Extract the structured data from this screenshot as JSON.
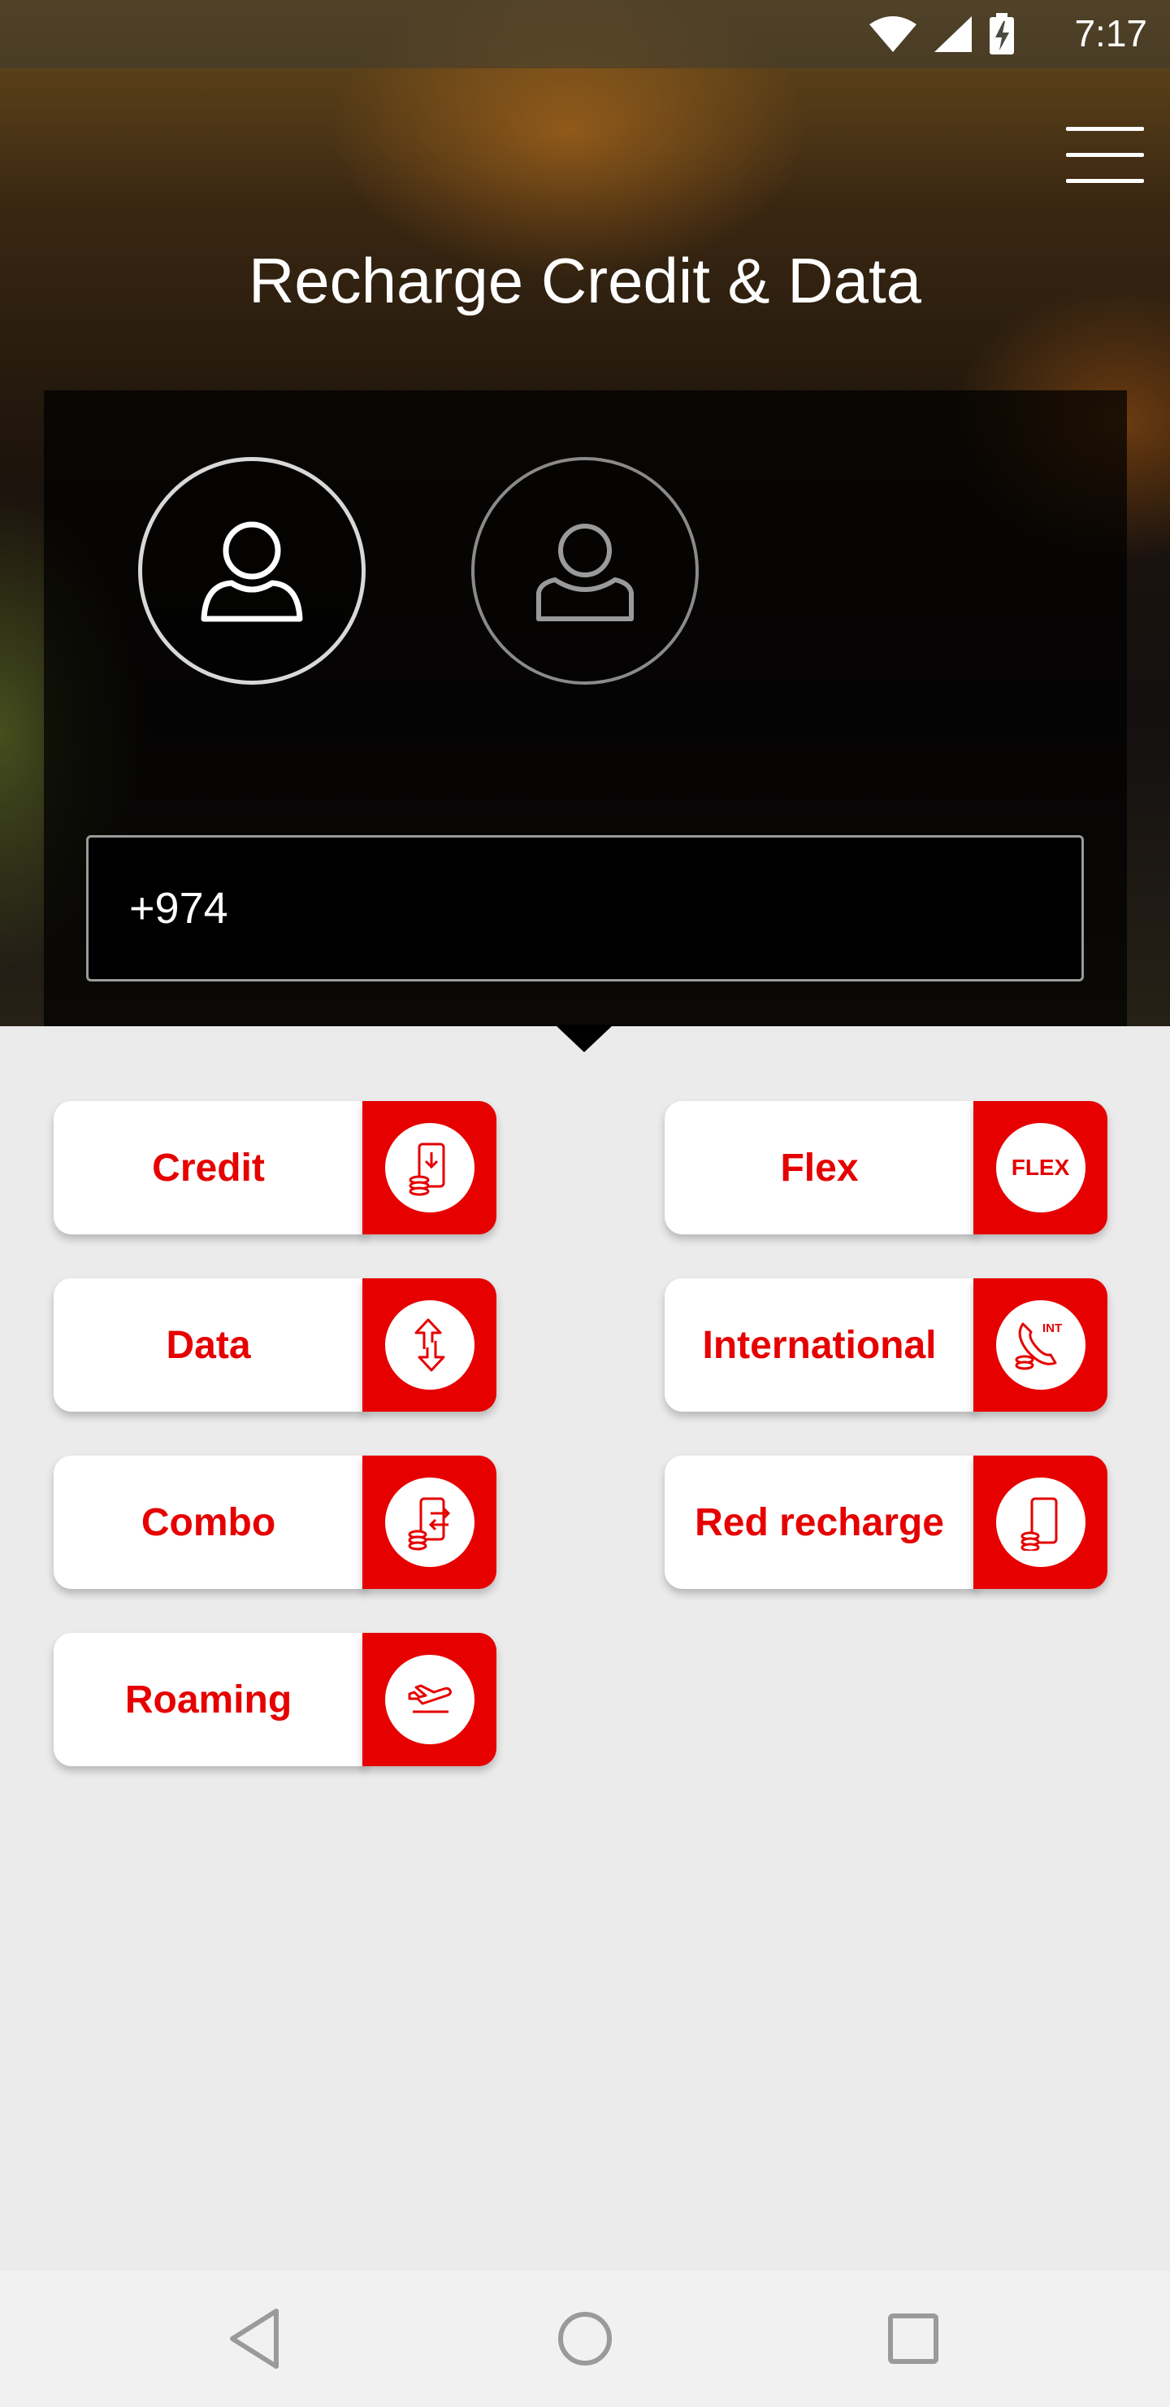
{
  "status_bar": {
    "time": "7:17",
    "icons": [
      "wifi-icon",
      "signal-icon",
      "battery-charging-icon"
    ]
  },
  "header": {
    "title": "Recharge Credit & Data",
    "menu_icon": "hamburger-menu-icon"
  },
  "recipient": {
    "options": [
      {
        "name": "myself",
        "icon": "user-icon",
        "selected": true
      },
      {
        "name": "other",
        "icon": "user-outline-icon",
        "selected": false
      }
    ],
    "phone_value": "+974"
  },
  "recharge_options": [
    {
      "label": "Credit",
      "icon": "phone-coins-icon"
    },
    {
      "label": "Flex",
      "icon": "flex-icon",
      "icon_text": "FLEX"
    },
    {
      "label": "Data",
      "icon": "data-arrows-icon"
    },
    {
      "label": "International",
      "icon": "international-call-icon",
      "icon_text": "INT"
    },
    {
      "label": "Combo",
      "icon": "combo-exchange-icon"
    },
    {
      "label": "Red recharge",
      "icon": "red-phone-coins-icon"
    },
    {
      "label": "Roaming",
      "icon": "airplane-icon"
    }
  ],
  "nav_bar": {
    "buttons": [
      "back-icon",
      "home-icon",
      "recents-icon"
    ]
  },
  "colors": {
    "accent": "#e60000",
    "sheet": "#ebebeb"
  }
}
